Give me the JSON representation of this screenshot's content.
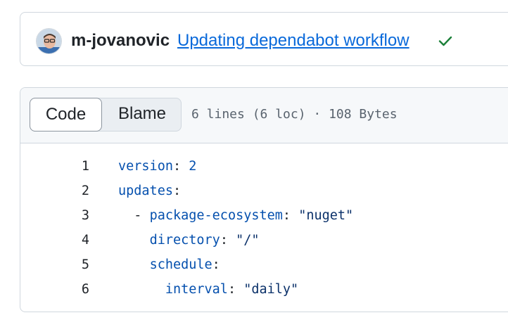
{
  "commit": {
    "author": "m-jovanovic",
    "message": "Updating dependabot workflow",
    "status_icon": "check-icon",
    "status_color": "#1a7f37"
  },
  "file": {
    "tabs": [
      "Code",
      "Blame"
    ],
    "active_tab": "Code",
    "info": "6 lines (6 loc) · 108 Bytes"
  },
  "code_lines": [
    {
      "num": "1",
      "indent": "",
      "dash": "",
      "key": "version",
      "colon": ":",
      "value": " 2"
    },
    {
      "num": "2",
      "indent": "",
      "dash": "",
      "key": "updates",
      "colon": ":",
      "value": ""
    },
    {
      "num": "3",
      "indent": "  ",
      "dash": "- ",
      "key": "package-ecosystem",
      "colon": ":",
      "value": " \"nuget\""
    },
    {
      "num": "4",
      "indent": "    ",
      "dash": "",
      "key": "directory",
      "colon": ":",
      "value": " \"/\""
    },
    {
      "num": "5",
      "indent": "    ",
      "dash": "",
      "key": "schedule",
      "colon": ":",
      "value": ""
    },
    {
      "num": "6",
      "indent": "      ",
      "dash": "",
      "key": "interval",
      "colon": ":",
      "value": " \"daily\""
    }
  ]
}
